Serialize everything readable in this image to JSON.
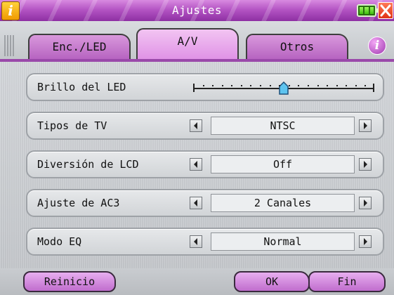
{
  "window": {
    "title": "Ajustes",
    "info_icon": "info-icon",
    "battery_icon": "battery-icon",
    "close_icon": "close-icon"
  },
  "tabs": [
    {
      "label": "Enc./LED",
      "active": false
    },
    {
      "label": "A/V",
      "active": true
    },
    {
      "label": "Otros",
      "active": false
    }
  ],
  "help_icon": "help-icon",
  "settings": {
    "led_brightness": {
      "label": "Brillo del LED",
      "level": 0.5
    },
    "tv_type": {
      "label": "Tipos de TV",
      "value": "NTSC"
    },
    "lcd_diversion": {
      "label": "Diversión de LCD",
      "value": "Off"
    },
    "ac3": {
      "label": "Ajuste de AC3",
      "value": "2 Canales"
    },
    "eq_mode": {
      "label": "Modo EQ",
      "value": "Normal"
    }
  },
  "buttons": {
    "reset": "Reinicio",
    "ok": "OK",
    "end": "Fin"
  },
  "colors": {
    "accent": "#b455c4",
    "tab_active": "#e093e6",
    "slider_thumb": "#5ec4ef"
  }
}
